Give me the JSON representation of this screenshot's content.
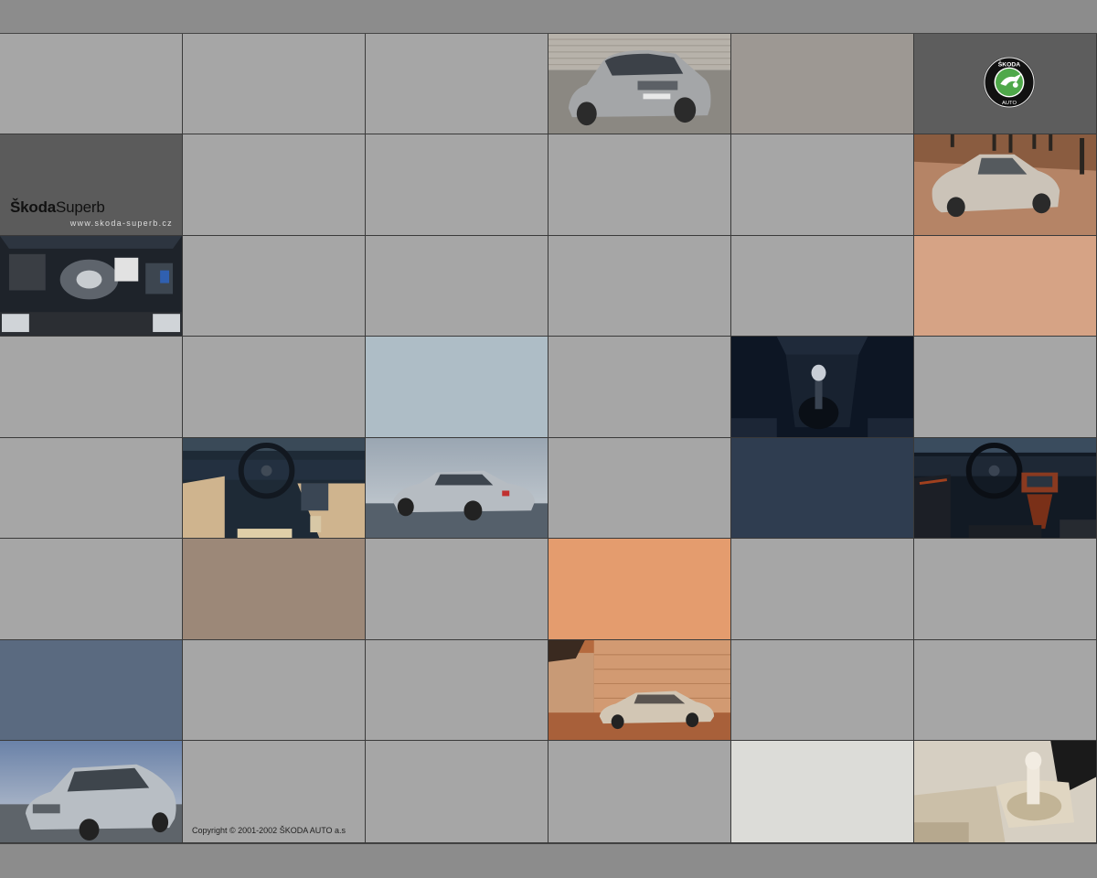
{
  "brand": {
    "name_bold": "Škoda",
    "name_regular": "Superb",
    "url": "www.skoda-superb.cz"
  },
  "logo": {
    "top_text": "ŠKODA",
    "bottom_text": "AUTO",
    "icon": "skoda-winged-arrow-icon"
  },
  "footer": {
    "copyright": "Copyright © 2001-2002 ŠKODA AUTO a.s"
  },
  "colors": {
    "tile_gray": "#a6a6a6",
    "tile_dark": "#5d5d5d",
    "tile_peach": "#d6a385",
    "tile_light_blue": "#aebdc6",
    "tile_navy": "#2f3d50",
    "tile_taupe": "#9c8878",
    "tile_orange": "#e49c6e",
    "tile_slate": "#5a6a80",
    "tile_offwhite": "#dcdcd8",
    "tile_warm_gray": "#9d9893",
    "logo_green": "#4fa84a"
  }
}
